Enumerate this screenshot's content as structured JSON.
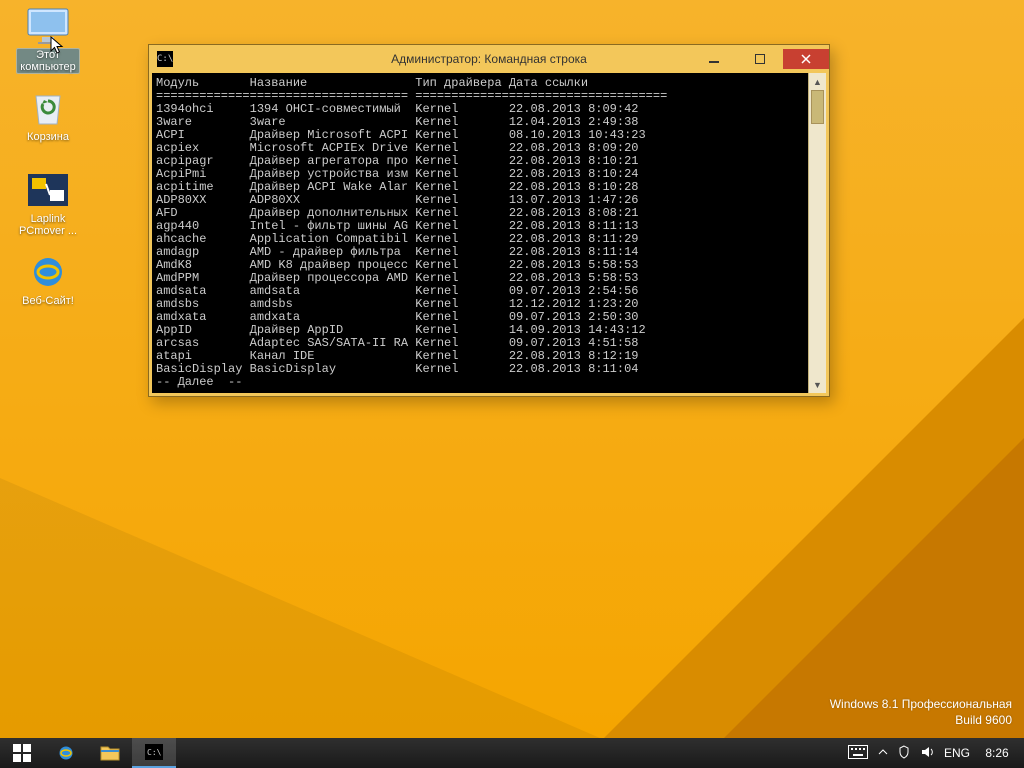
{
  "desktop_icons": [
    {
      "label": "Этот\nкомпьютер"
    },
    {
      "label": "Корзина"
    },
    {
      "label": "Laplink\nPCmover ..."
    },
    {
      "label": "Веб-Сайт!"
    }
  ],
  "watermark": {
    "line1": "Windows 8.1 Профессиональная",
    "line2": "Build 9600"
  },
  "cmd": {
    "title": "Администратор: Командная строка",
    "icon_glyph": "C:\\",
    "header": {
      "module": "Модуль",
      "name": "Название",
      "type": "Тип драйвера",
      "date": "Дата ссылки"
    },
    "rows": [
      {
        "m": "1394ohci",
        "n": "1394 OHCI-совместимый",
        "t": "Kernel",
        "d": "22.08.2013 8:09:42"
      },
      {
        "m": "3ware",
        "n": "3ware",
        "t": "Kernel",
        "d": "12.04.2013 2:49:38"
      },
      {
        "m": "ACPI",
        "n": "Драйвер Microsoft ACPI",
        "t": "Kernel",
        "d": "08.10.2013 10:43:23"
      },
      {
        "m": "acpiex",
        "n": "Microsoft ACPIEx Drive",
        "t": "Kernel",
        "d": "22.08.2013 8:09:20"
      },
      {
        "m": "acpipagr",
        "n": "Драйвер агрегатора про",
        "t": "Kernel",
        "d": "22.08.2013 8:10:21"
      },
      {
        "m": "AcpiPmi",
        "n": "Драйвер устройства изм",
        "t": "Kernel",
        "d": "22.08.2013 8:10:24"
      },
      {
        "m": "acpitime",
        "n": "Драйвер ACPI Wake Alar",
        "t": "Kernel",
        "d": "22.08.2013 8:10:28"
      },
      {
        "m": "ADP80XX",
        "n": "ADP80XX",
        "t": "Kernel",
        "d": "13.07.2013 1:47:26"
      },
      {
        "m": "AFD",
        "n": "Драйвер дополнительных",
        "t": "Kernel",
        "d": "22.08.2013 8:08:21"
      },
      {
        "m": "agp440",
        "n": "Intel - фильтр шины AG",
        "t": "Kernel",
        "d": "22.08.2013 8:11:13"
      },
      {
        "m": "ahcache",
        "n": "Application Compatibil",
        "t": "Kernel",
        "d": "22.08.2013 8:11:29"
      },
      {
        "m": "amdagp",
        "n": "AMD - драйвер фильтра",
        "t": "Kernel",
        "d": "22.08.2013 8:11:14"
      },
      {
        "m": "AmdK8",
        "n": "AMD K8 драйвер процесс",
        "t": "Kernel",
        "d": "22.08.2013 5:58:53"
      },
      {
        "m": "AmdPPM",
        "n": "Драйвер процессора AMD",
        "t": "Kernel",
        "d": "22.08.2013 5:58:53"
      },
      {
        "m": "amdsata",
        "n": "amdsata",
        "t": "Kernel",
        "d": "09.07.2013 2:54:56"
      },
      {
        "m": "amdsbs",
        "n": "amdsbs",
        "t": "Kernel",
        "d": "12.12.2012 1:23:20"
      },
      {
        "m": "amdxata",
        "n": "amdxata",
        "t": "Kernel",
        "d": "09.07.2013 2:50:30"
      },
      {
        "m": "AppID",
        "n": "Драйвер AppID",
        "t": "Kernel",
        "d": "14.09.2013 14:43:12"
      },
      {
        "m": "arcsas",
        "n": "Adaptec SAS/SATA-II RA",
        "t": "Kernel",
        "d": "09.07.2013 4:51:58"
      },
      {
        "m": "atapi",
        "n": "Канал IDE",
        "t": "Kernel",
        "d": "22.08.2013 8:12:19"
      },
      {
        "m": "BasicDisplay",
        "n": "BasicDisplay",
        "t": "Kernel",
        "d": "22.08.2013 8:11:04"
      }
    ],
    "more": "-- Далее  --"
  },
  "taskbar": {
    "lang": "ENG",
    "clock": "8:26"
  }
}
